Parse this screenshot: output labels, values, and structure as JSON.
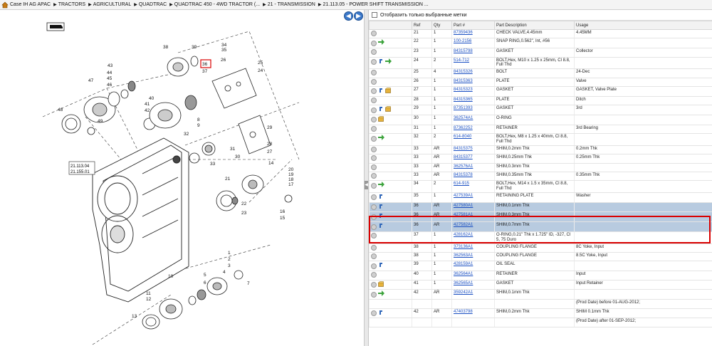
{
  "breadcrumb": [
    {
      "label": "Case IH AG APAC"
    },
    {
      "label": "TRACTORS"
    },
    {
      "label": "AGRICULTURAL"
    },
    {
      "label": "QUADTRAC"
    },
    {
      "label": "QUADTRAC 450 - 4WD TRACTOR (..."
    },
    {
      "label": "21 - TRANSMISSION"
    },
    {
      "label": "21.113.05 - POWER SHIFT TRANSMISSION ..."
    }
  ],
  "filter": {
    "label": "Отобразить только выбранные метки"
  },
  "table": {
    "headers": {
      "ref": "Ref",
      "qty": "Qty",
      "part": "Part #",
      "desc": "Part Description",
      "usage": "Usage"
    },
    "rows": [
      {
        "ref": "21",
        "qty": "1",
        "part": "87359436",
        "desc": "CHECK VALVE,4.45mm",
        "usage": "4.45MM",
        "icons": []
      },
      {
        "ref": "22",
        "qty": "1",
        "part": "100-2156",
        "desc": "SNAP RING,0.562\", Int, #56",
        "usage": "",
        "icons": [
          "arrow"
        ]
      },
      {
        "ref": "23",
        "qty": "1",
        "part": "84315798",
        "desc": "GASKET",
        "usage": "Collector",
        "icons": []
      },
      {
        "ref": "24",
        "qty": "2",
        "part": "514-712",
        "desc": "BOLT,Hex, M10 x 1.25 x 25mm, Cl 8.8, Full Thd",
        "usage": "",
        "icons": [
          "loop",
          "arrow"
        ]
      },
      {
        "ref": "25",
        "qty": "4",
        "part": "84315326",
        "desc": "BOLT",
        "usage": "24-Dec",
        "icons": []
      },
      {
        "ref": "26",
        "qty": "1",
        "part": "84315363",
        "desc": "PLATE",
        "usage": "Valve",
        "icons": []
      },
      {
        "ref": "27",
        "qty": "1",
        "part": "84315323",
        "desc": "GASKET",
        "usage": "GASKET, Valve Plate",
        "icons": [
          "loop",
          "box"
        ]
      },
      {
        "ref": "28",
        "qty": "1",
        "part": "84315365",
        "desc": "PLATE",
        "usage": "Ditch",
        "icons": []
      },
      {
        "ref": "29",
        "qty": "1",
        "part": "87351393",
        "desc": "GASKET",
        "usage": "3rd",
        "icons": [
          "loop",
          "box"
        ]
      },
      {
        "ref": "30",
        "qty": "1",
        "part": "362574A1",
        "desc": "O-RING",
        "usage": "",
        "icons": [
          "box"
        ]
      },
      {
        "ref": "31",
        "qty": "1",
        "part": "87362252",
        "desc": "RETAINER",
        "usage": "3rd Bearing",
        "icons": []
      },
      {
        "ref": "32",
        "qty": "2",
        "part": "614-8040",
        "desc": "BOLT,Hex, M8 x 1.25 x 40mm, Cl 8.8, Full Thd",
        "usage": "",
        "icons": [
          "arrow"
        ]
      },
      {
        "ref": "33",
        "qty": "AR",
        "part": "84315375",
        "desc": "SHIM,0.2mm Thk",
        "usage": "0.2mm Thk",
        "icons": []
      },
      {
        "ref": "33",
        "qty": "AR",
        "part": "84315377",
        "desc": "SHIM,0.25mm Thk",
        "usage": "0.25mm Thk",
        "icons": []
      },
      {
        "ref": "33",
        "qty": "AR",
        "part": "362576A1",
        "desc": "SHIM,0.3mm Thk",
        "usage": "",
        "icons": []
      },
      {
        "ref": "33",
        "qty": "AR",
        "part": "84315378",
        "desc": "SHIM,0.35mm Thk",
        "usage": "0.35mm Thk",
        "icons": []
      },
      {
        "ref": "34",
        "qty": "2",
        "part": "614-915",
        "desc": "BOLT,Hex, M14 x 1.5 x 35mm, Cl 8.8, Full Thd",
        "usage": "",
        "icons": [
          "arrow"
        ]
      },
      {
        "ref": "35",
        "qty": "1",
        "part": "427539A1",
        "desc": "RETAINING PLATE",
        "usage": "Washer",
        "icons": [
          "loop"
        ]
      },
      {
        "ref": "36",
        "qty": "AR",
        "part": "427580A1",
        "desc": "SHIM,0.1mm Thk",
        "usage": "",
        "icons": [
          "loop"
        ],
        "selected": true
      },
      {
        "ref": "36",
        "qty": "AR",
        "part": "427581A1",
        "desc": "SHIM,0.3mm Thk",
        "usage": "",
        "icons": [
          "loop"
        ],
        "selected": true
      },
      {
        "ref": "36",
        "qty": "AR",
        "part": "427582A1",
        "desc": "SHIM,0.7mm Thk",
        "usage": "",
        "icons": [
          "loop"
        ],
        "selected": true
      },
      {
        "ref": "37",
        "qty": "1",
        "part": "428162A1",
        "desc": "O-RING,0.21\" Thk x 1.725\" ID, -327, Cl 5, 75 Duro",
        "usage": "",
        "icons": []
      },
      {
        "ref": "38",
        "qty": "1",
        "part": "373136A1",
        "desc": "COUPLING FLANGE",
        "usage": "8C Yoke, Input",
        "icons": []
      },
      {
        "ref": "38",
        "qty": "1",
        "part": "362563A1",
        "desc": "COUPLING FLANGE",
        "usage": "8.5C Yoke, Input",
        "icons": []
      },
      {
        "ref": "39",
        "qty": "1",
        "part": "428159A1",
        "desc": "OIL SEAL",
        "usage": "",
        "icons": [
          "loop"
        ]
      },
      {
        "ref": "40",
        "qty": "1",
        "part": "362564A1",
        "desc": "RETAINER",
        "usage": "Input",
        "icons": []
      },
      {
        "ref": "41",
        "qty": "1",
        "part": "362565A1",
        "desc": "GASKET",
        "usage": "Input Retainer",
        "icons": [
          "box"
        ]
      },
      {
        "ref": "42",
        "qty": "AR",
        "part": "359242A1",
        "desc": "SHIM,0.1mm Thk",
        "usage": "",
        "icons": [
          "arrow"
        ]
      },
      {
        "ref": "",
        "qty": "",
        "part": "",
        "desc": "",
        "usage": "(Prod Date) before 01-AUG-2012;",
        "icons": [],
        "cont": true
      },
      {
        "ref": "42",
        "qty": "AR",
        "part": "47403798",
        "desc": "SHIM,0.2mm Thk",
        "usage": "SHIM 0.1mm Thk",
        "icons": [
          "loop"
        ]
      },
      {
        "ref": "",
        "qty": "",
        "part": "",
        "desc": "",
        "usage": "(Prod Date) after 01-SEP-2012;",
        "icons": [],
        "cont": true
      }
    ]
  },
  "diagram": {
    "callouts": [
      "1",
      "2",
      "3",
      "4",
      "5",
      "6",
      "7",
      "8",
      "9",
      "10",
      "11",
      "12",
      "13",
      "14",
      "15",
      "16",
      "17",
      "18",
      "19",
      "20",
      "21",
      "22",
      "23",
      "24",
      "25",
      "26",
      "27",
      "28",
      "29",
      "30",
      "31",
      "32",
      "33",
      "34",
      "35",
      "36",
      "37",
      "38",
      "39",
      "40",
      "41",
      "42",
      "43",
      "44",
      "45",
      "46",
      "47",
      "48",
      "49"
    ],
    "refs": [
      "21.113.04",
      "21.155.01"
    ],
    "highlighted": "36"
  },
  "colors": {
    "selection": "#b8cbe0",
    "highlight_box": "#d90000",
    "link": "#1a4fc2",
    "nav_button": "#3b78c9"
  }
}
